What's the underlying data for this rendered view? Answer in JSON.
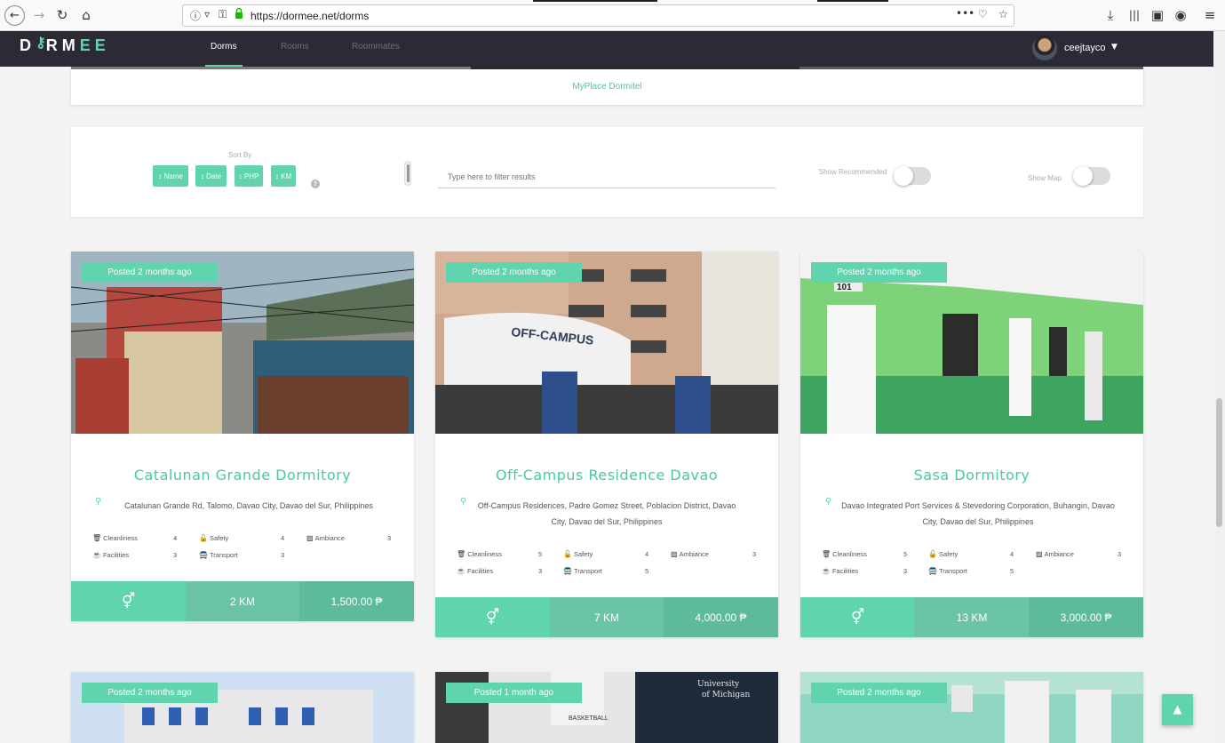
{
  "browser": {
    "url": "https://dormee.net/dorms"
  },
  "nav": {
    "logo": "D RMEE",
    "links": [
      "Dorms",
      "Rooms",
      "Roommates"
    ],
    "username": "ceejtayco"
  },
  "topcard": {
    "name": "MyPlace Dormitel"
  },
  "filter": {
    "sort_by_label": "Sort By",
    "sort_buttons": [
      "Name",
      "Date",
      "PHP",
      "KM"
    ],
    "search_placeholder": "Type here to filter results",
    "show_recommended": "Show Recommended",
    "show_map": "Show Map"
  },
  "dorms": [
    {
      "posted": "Posted 2 months ago",
      "name": "Catalunan Grande Dormitory",
      "address": "Catalunan Grande Rd, Talomo, Davao City, Davao del Sur, Philippines",
      "ratings": {
        "cleanliness": "4",
        "safety": "4",
        "ambiance": "3",
        "facilities": "3",
        "transport": "3"
      },
      "distance": "2 KM",
      "price": "1,500.00 ₱"
    },
    {
      "posted": "Posted 2 months ago",
      "name": "Off-Campus Residence Davao",
      "address": "Off-Campus Residences, Padre Gomez Street, Poblacion District, Davao City, Davao del Sur, Philippines",
      "ratings": {
        "cleanliness": "5",
        "safety": "4",
        "ambiance": "3",
        "facilities": "3",
        "transport": "5"
      },
      "distance": "7 KM",
      "price": "4,000.00 ₱"
    },
    {
      "posted": "Posted 2 months ago",
      "name": "Sasa Dormitory",
      "address": "Davao Integrated Port Services & Stevedoring Corporation, Buhangin, Davao City, Davao del Sur, Philippines",
      "ratings": {
        "cleanliness": "5",
        "safety": "4",
        "ambiance": "3",
        "facilities": "3",
        "transport": "5"
      },
      "distance": "13 KM",
      "price": "3,000.00 ₱"
    },
    {
      "posted": "Posted 2 months ago"
    },
    {
      "posted": "Posted 1 month ago"
    },
    {
      "posted": "Posted 2 months ago"
    }
  ],
  "rating_labels": {
    "cleanliness": "Cleanliness",
    "safety": "Safety",
    "ambiance": "Ambiance",
    "facilities": "Facilities",
    "transport": "Transport"
  },
  "icons": {
    "gender": "gender-icon",
    "pin": "map-pin-icon",
    "scroll_top": "arrow-up-icon"
  },
  "colors": {
    "accent": "#5fd4ae",
    "nav_bg": "#2b2a35"
  }
}
